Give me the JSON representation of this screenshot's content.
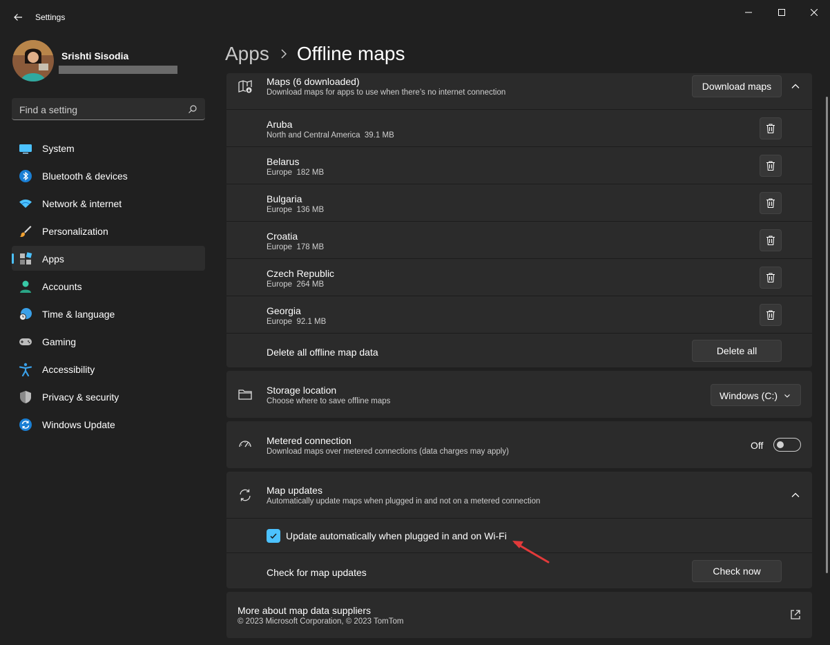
{
  "window": {
    "title": "Settings"
  },
  "profile": {
    "name": "Srishti Sisodia"
  },
  "search": {
    "placeholder": "Find a setting"
  },
  "nav": {
    "items": [
      {
        "label": "System",
        "icon": "system-icon"
      },
      {
        "label": "Bluetooth & devices",
        "icon": "bluetooth-icon"
      },
      {
        "label": "Network & internet",
        "icon": "wifi-icon"
      },
      {
        "label": "Personalization",
        "icon": "brush-icon"
      },
      {
        "label": "Apps",
        "icon": "apps-icon",
        "active": true
      },
      {
        "label": "Accounts",
        "icon": "person-icon"
      },
      {
        "label": "Time & language",
        "icon": "globe-clock-icon"
      },
      {
        "label": "Gaming",
        "icon": "gamepad-icon"
      },
      {
        "label": "Accessibility",
        "icon": "accessibility-icon"
      },
      {
        "label": "Privacy & security",
        "icon": "shield-icon"
      },
      {
        "label": "Windows Update",
        "icon": "update-icon"
      }
    ]
  },
  "breadcrumb": {
    "parent": "Apps",
    "current": "Offline maps"
  },
  "maps_card": {
    "title": "Maps (6 downloaded)",
    "subtitle": "Download maps for apps to use when there’s no internet connection",
    "download_label": "Download maps",
    "maps": [
      {
        "name": "Aruba",
        "region": "North and Central America",
        "size": "39.1 MB"
      },
      {
        "name": "Belarus",
        "region": "Europe",
        "size": "182 MB"
      },
      {
        "name": "Bulgaria",
        "region": "Europe",
        "size": "136 MB"
      },
      {
        "name": "Croatia",
        "region": "Europe",
        "size": "178 MB"
      },
      {
        "name": "Czech Republic",
        "region": "Europe",
        "size": "264 MB"
      },
      {
        "name": "Georgia",
        "region": "Europe",
        "size": "92.1 MB"
      }
    ],
    "delete_all_text": "Delete all offline map data",
    "delete_all_label": "Delete all"
  },
  "storage": {
    "title": "Storage location",
    "subtitle": "Choose where to save offline maps",
    "selected": "Windows (C:)"
  },
  "metered": {
    "title": "Metered connection",
    "subtitle": "Download maps over metered connections (data charges may apply)",
    "state_label": "Off"
  },
  "updates": {
    "title": "Map updates",
    "subtitle": "Automatically update maps when plugged in and not on a metered connection",
    "checkbox_label": "Update automatically when plugged in and on Wi-Fi",
    "check_text": "Check for map updates",
    "check_label": "Check now"
  },
  "suppliers": {
    "title": "More about map data suppliers",
    "subtitle": "© 2023 Microsoft Corporation, © 2023 TomTom"
  },
  "colors": {
    "accent": "#4cc2ff",
    "annotation_arrow": "#e23a3a"
  }
}
